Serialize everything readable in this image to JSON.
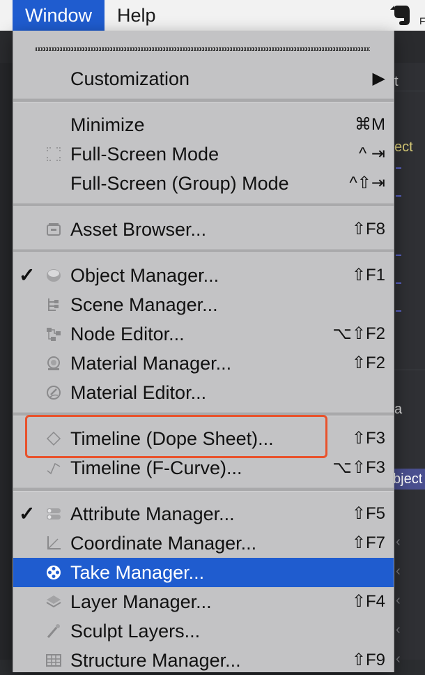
{
  "menubar": {
    "items": [
      {
        "label": "Window",
        "active": true
      },
      {
        "label": "Help",
        "active": false
      }
    ],
    "status_icon": "evernote-icon",
    "status_extra": "F"
  },
  "background": {
    "labels": [
      "t",
      "ect",
      "a",
      "bject"
    ]
  },
  "menu": {
    "items": [
      {
        "label": "Customization",
        "shortcut": "▶",
        "checked": false,
        "icon": "none"
      },
      {
        "label": "Minimize",
        "shortcut": "⌘M",
        "checked": false,
        "icon": "none"
      },
      {
        "label": "Full-Screen Mode",
        "shortcut": "^ ⇥",
        "checked": false,
        "icon": "fullscreen-icon"
      },
      {
        "label": "Full-Screen (Group) Mode",
        "shortcut": "^⇧⇥",
        "checked": false,
        "icon": "none"
      },
      {
        "label": "Asset Browser...",
        "shortcut": "⇧F8",
        "checked": false,
        "icon": "asset-browser-icon"
      },
      {
        "label": "Object Manager...",
        "shortcut": "⇧F1",
        "checked": true,
        "icon": "object-manager-icon"
      },
      {
        "label": "Scene Manager...",
        "shortcut": "",
        "checked": false,
        "icon": "scene-manager-icon"
      },
      {
        "label": "Node Editor...",
        "shortcut": "⌥⇧F2",
        "checked": false,
        "icon": "node-editor-icon"
      },
      {
        "label": "Material Manager...",
        "shortcut": "⇧F2",
        "checked": false,
        "icon": "material-manager-icon"
      },
      {
        "label": "Material Editor...",
        "shortcut": "",
        "checked": false,
        "icon": "material-editor-icon"
      },
      {
        "label": "Timeline (Dope Sheet)...",
        "shortcut": "⇧F3",
        "checked": false,
        "icon": "timeline-dope-sheet-icon"
      },
      {
        "label": "Timeline (F-Curve)...",
        "shortcut": "⌥⇧F3",
        "checked": false,
        "icon": "timeline-fcurve-icon"
      },
      {
        "label": "Attribute Manager...",
        "shortcut": "⇧F5",
        "checked": true,
        "icon": "attribute-manager-icon"
      },
      {
        "label": "Coordinate Manager...",
        "shortcut": "⇧F7",
        "checked": false,
        "icon": "coordinate-manager-icon"
      },
      {
        "label": "Take Manager...",
        "shortcut": "",
        "checked": false,
        "icon": "take-manager-icon",
        "highlighted": true
      },
      {
        "label": "Layer Manager...",
        "shortcut": "⇧F4",
        "checked": false,
        "icon": "layer-manager-icon"
      },
      {
        "label": "Sculpt Layers...",
        "shortcut": "",
        "checked": false,
        "icon": "sculpt-layers-icon"
      },
      {
        "label": "Structure Manager...",
        "shortcut": "⇧F9",
        "checked": false,
        "icon": "structure-manager-icon"
      }
    ],
    "check_glyph": "✓"
  },
  "colors": {
    "highlight": "#1f5ccf",
    "annotation": "#e8522c"
  }
}
